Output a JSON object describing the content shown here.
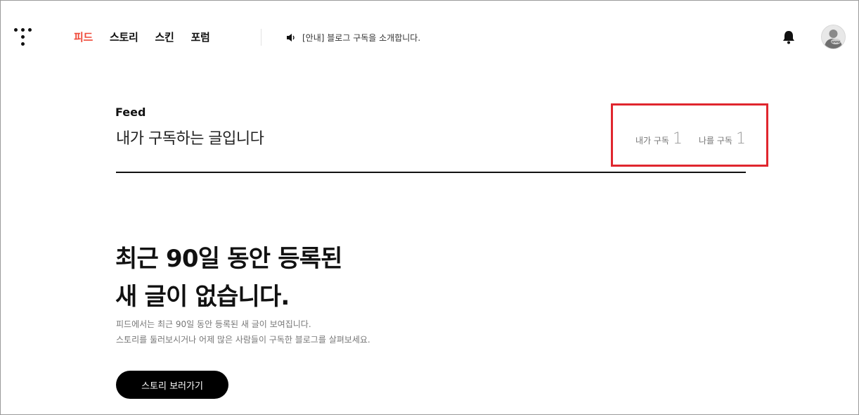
{
  "nav": {
    "items": [
      {
        "label": "피드",
        "active": true
      },
      {
        "label": "스토리",
        "active": false
      },
      {
        "label": "스킨",
        "active": false
      },
      {
        "label": "포럼",
        "active": false
      }
    ]
  },
  "notice": {
    "text": "[안내] 블로그 구독을 소개합니다.",
    "icon": "speaker-icon"
  },
  "header_icons": {
    "bell": "bell-icon",
    "avatar": "avatar"
  },
  "feed": {
    "label": "Feed",
    "subtitle": "내가 구독하는 글입니다",
    "stats": [
      {
        "label": "내가 구독",
        "count": "1"
      },
      {
        "label": "나를 구독",
        "count": "1"
      }
    ]
  },
  "empty": {
    "title_line1": "최근 90일 동안 등록된",
    "title_line2": "새 글이 없습니다.",
    "desc_line1": "피드에서는 최근 90일 동안 등록된 새 글이 보여집니다.",
    "desc_line2": "스토리를 둘러보시거나 어제 많은 사람들이 구독한 블로그를 살펴보세요.",
    "button_label": "스토리 보러가기"
  },
  "colors": {
    "accent": "#ef4a3a",
    "highlight_box": "#e0262e"
  }
}
